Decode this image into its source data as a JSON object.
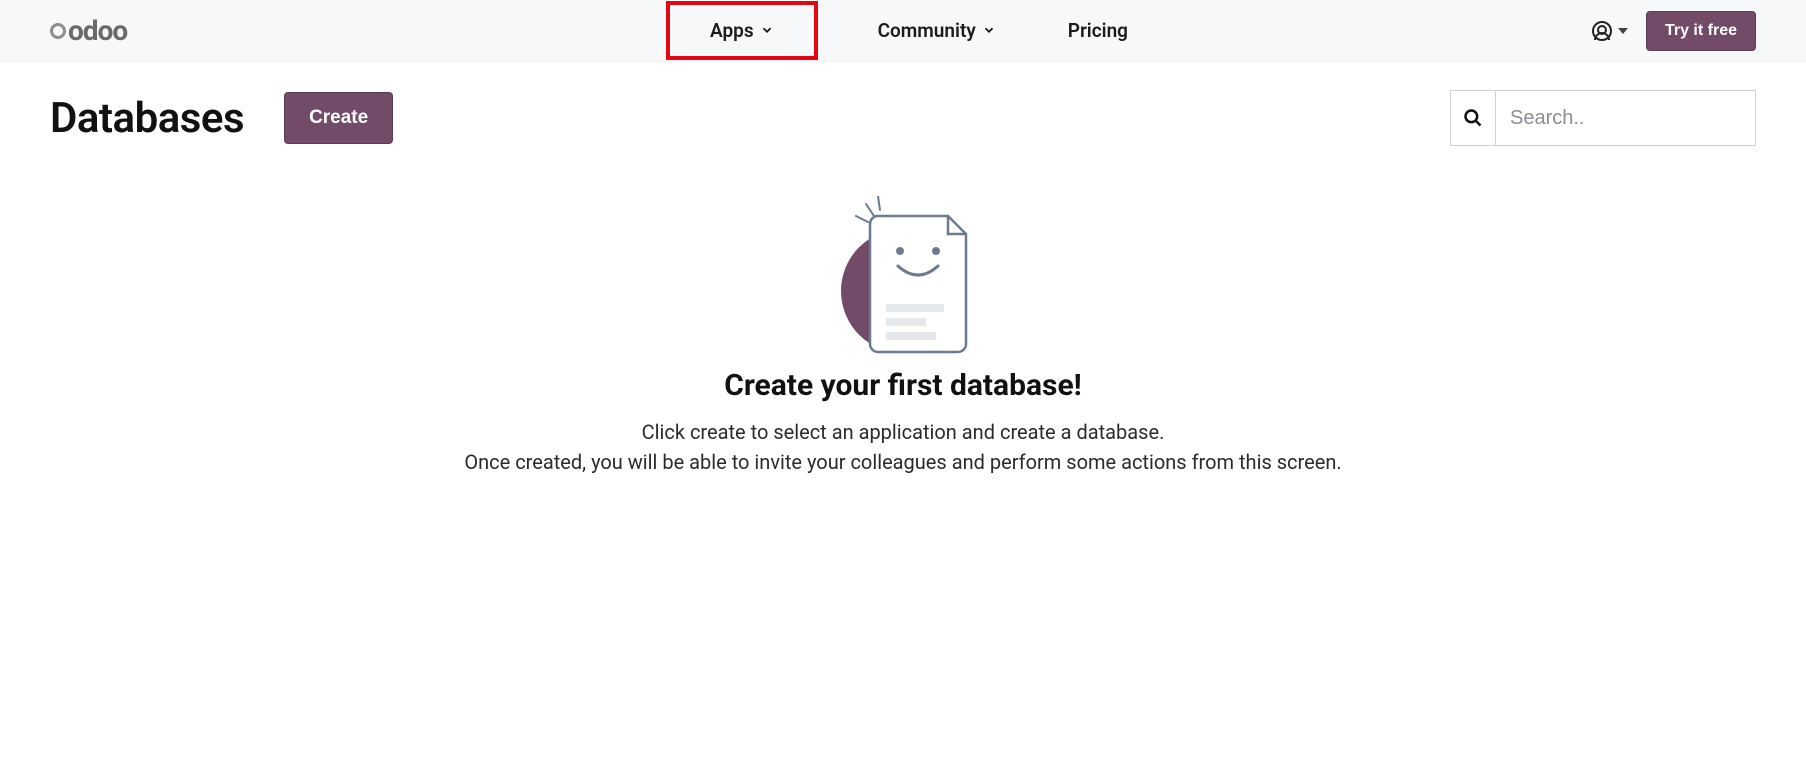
{
  "brand": "odoo",
  "nav": {
    "apps": "Apps",
    "community": "Community",
    "pricing": "Pricing",
    "try_free": "Try it free"
  },
  "page": {
    "title": "Databases",
    "create_button": "Create"
  },
  "search": {
    "placeholder": "Search.."
  },
  "empty_state": {
    "heading": "Create your first database!",
    "line1": "Click create to select an application and create a database.",
    "line2": "Once created, you will be able to invite your colleagues and perform some actions from this screen."
  },
  "colors": {
    "accent": "#714b67",
    "highlight_border": "#e30613"
  }
}
